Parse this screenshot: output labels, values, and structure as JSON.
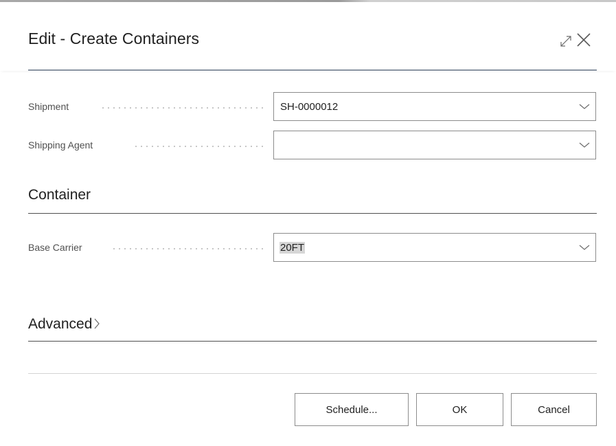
{
  "dialog": {
    "title": "Edit - Create Containers",
    "header_icons": [
      "expand-icon",
      "close-icon"
    ]
  },
  "fields": {
    "shipment": {
      "label": "Shipment",
      "value": "SH-0000012"
    },
    "shipping_agent": {
      "label": "Shipping Agent",
      "value": ""
    }
  },
  "container_section": {
    "title": "Container",
    "base_carrier": {
      "label": "Base Carrier",
      "value": "20FT"
    }
  },
  "advanced_section": {
    "title": "Advanced"
  },
  "footer": {
    "schedule_label": "Schedule...",
    "ok_label": "OK",
    "cancel_label": "Cancel"
  },
  "colors": {
    "header_divider": "#8a95a3",
    "input_border": "#8c8c8c",
    "selection_highlight": "#d6d6d6",
    "text": "#212121"
  }
}
